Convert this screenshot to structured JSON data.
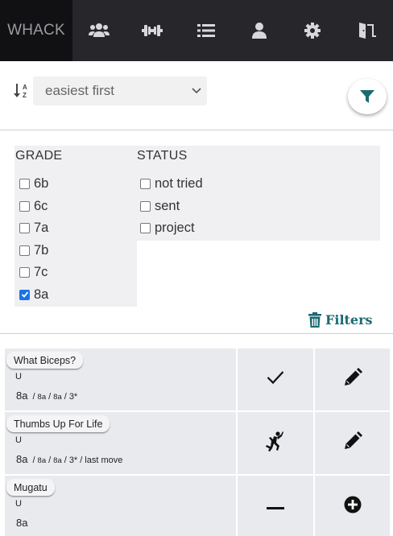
{
  "nav": {
    "brand": "WHACK",
    "items": [
      {
        "icon": "users-icon"
      },
      {
        "icon": "dumbbell-icon"
      },
      {
        "icon": "list-icon"
      },
      {
        "icon": "user-icon"
      },
      {
        "icon": "gear-icon"
      },
      {
        "icon": "exit-door-icon"
      }
    ]
  },
  "sort": {
    "selected": "easiest first",
    "icon": "sort-alpha-icon"
  },
  "filters": {
    "grade_header": "GRADE",
    "status_header": "STATUS",
    "grades": [
      {
        "label": "6b",
        "checked": false
      },
      {
        "label": "6c",
        "checked": false
      },
      {
        "label": "7a",
        "checked": false
      },
      {
        "label": "7b",
        "checked": false
      },
      {
        "label": "7c",
        "checked": false
      },
      {
        "label": "8a",
        "checked": true
      }
    ],
    "statuses": [
      {
        "label": "not tried",
        "checked": false
      },
      {
        "label": "sent",
        "checked": false
      },
      {
        "label": "project",
        "checked": false
      }
    ],
    "clear_label": "Filters"
  },
  "routes": [
    {
      "name": "What Biceps?",
      "sector": "U",
      "grade": "8a",
      "grade_votes": [
        "8a",
        "8a"
      ],
      "stars": "3*",
      "extra": "",
      "status_icon": "checkmark-icon",
      "action_icon": "pencil-icon"
    },
    {
      "name": "Thumbs Up For Life",
      "sector": "U",
      "grade": "8a",
      "grade_votes": [
        "8a",
        "8a"
      ],
      "stars": "3*",
      "extra": "last move",
      "status_icon": "climber-icon",
      "action_icon": "pencil-icon"
    },
    {
      "name": "Mugatu",
      "sector": "U",
      "grade": "8a",
      "grade_votes": [],
      "stars": "",
      "extra": "",
      "status_icon": "minus-icon",
      "action_icon": "plus-circle-icon"
    }
  ],
  "colors": {
    "nav_bg": "#26262b",
    "brand_bg": "#111114",
    "accent_teal": "#1b6a72",
    "cell_bg": "#e9eaee",
    "checkbox_checked": "#1a73e8"
  }
}
